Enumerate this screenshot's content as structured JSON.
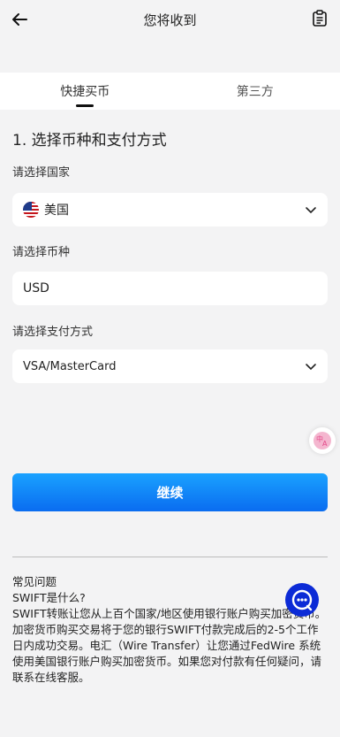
{
  "header": {
    "title": "您将收到"
  },
  "tabs": [
    {
      "label": "快捷买币"
    },
    {
      "label": "第三方"
    }
  ],
  "section_title": "1. 选择币种和支付方式",
  "form": {
    "country_label": "请选择国家",
    "country_value": "美国",
    "currency_label": "请选择币种",
    "currency_value": "USD",
    "payment_label": "请选择支付方式",
    "payment_value": "VSA/MasterCard"
  },
  "continue_label": "继续",
  "faq": {
    "title": "常见问题",
    "question": "SWIFT是什么?",
    "answer": "SWIFT转账让您从上百个国家/地区使用银行账户购买加密货币。加密货币购买交易将于您的银行SWIFT付款完成后的2-5个工作日内成功交易。电汇（Wire Transfer）让您通过FedWire 系统使用美国银行账户购买加密货币。如果您对付款有任何疑问，请联系在线客服。"
  },
  "icons": {
    "back": "arrow-left-icon",
    "doc": "document-list-icon",
    "flag": "us-flag-icon",
    "chevron": "chevron-down-icon",
    "chat": "chat-support-icon",
    "translate": "translate-icon"
  },
  "colors": {
    "accent": "#0a6cf0",
    "chat": "#0c2bd6",
    "translate": "#e54a8a"
  }
}
